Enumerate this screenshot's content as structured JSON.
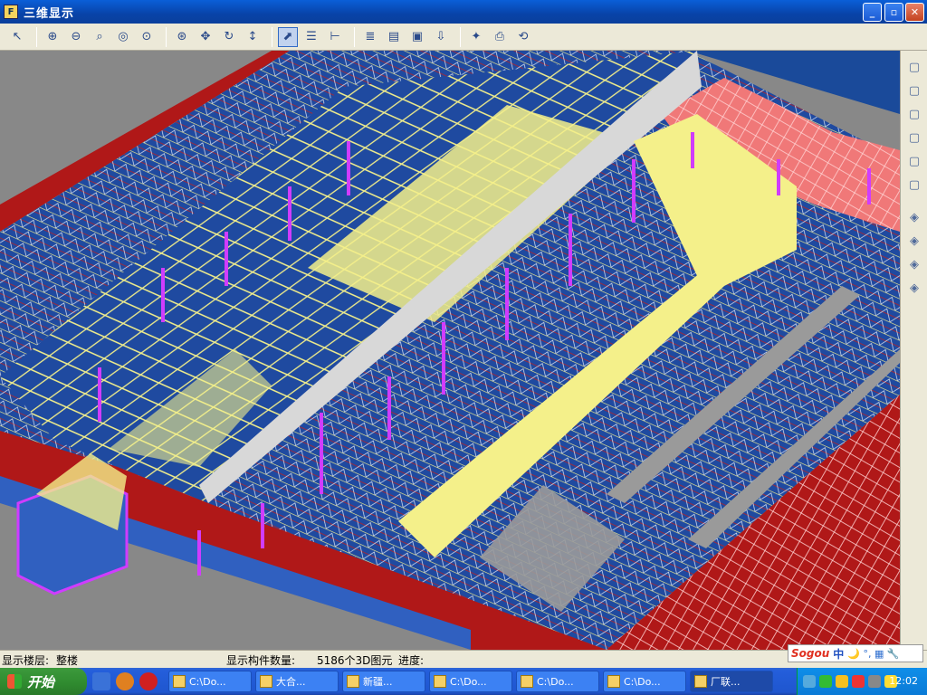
{
  "window": {
    "title": "三维显示",
    "app_icon_glyph": "F",
    "minimize_glyph": "_",
    "maximize_glyph": "▫",
    "close_glyph": "✕"
  },
  "toolbar": {
    "buttons": [
      {
        "name": "select-tool-icon",
        "glyph": "↖"
      },
      {
        "name": "zoom-in-icon",
        "glyph": "⊕"
      },
      {
        "name": "zoom-out-icon",
        "glyph": "⊖"
      },
      {
        "name": "zoom-window-icon",
        "glyph": "⌕"
      },
      {
        "name": "zoom-previous-icon",
        "glyph": "◎"
      },
      {
        "name": "zoom-all-icon",
        "glyph": "⊙"
      },
      {
        "name": "zoom-extents-icon",
        "glyph": "⊛"
      },
      {
        "name": "pan-icon",
        "glyph": "✥"
      },
      {
        "name": "rotate-icon",
        "glyph": "↻"
      },
      {
        "name": "vertical-move-icon",
        "glyph": "↕"
      },
      {
        "name": "orbit-icon",
        "glyph": "⬈"
      },
      {
        "name": "layers-icon",
        "glyph": "☰"
      },
      {
        "name": "filter-icon",
        "glyph": "⊢"
      },
      {
        "name": "list-icon",
        "glyph": "≣"
      },
      {
        "name": "properties-icon",
        "glyph": "▤"
      },
      {
        "name": "display-settings-icon",
        "glyph": "▣"
      },
      {
        "name": "export-icon",
        "glyph": "⇩"
      },
      {
        "name": "disabled-tool-icon",
        "glyph": "✦"
      },
      {
        "name": "print-preview-icon",
        "glyph": "⎙"
      },
      {
        "name": "refresh-icon",
        "glyph": "⟲"
      }
    ]
  },
  "rightbar": {
    "buttons": [
      {
        "name": "view-top-icon",
        "glyph": "▢"
      },
      {
        "name": "view-front-icon",
        "glyph": "▢"
      },
      {
        "name": "view-left-icon",
        "glyph": "▢"
      },
      {
        "name": "view-right-icon",
        "glyph": "▢"
      },
      {
        "name": "view-back-icon",
        "glyph": "▢"
      },
      {
        "name": "view-bottom-icon",
        "glyph": "▢"
      },
      {
        "name": "iso-sw-icon",
        "glyph": "◈"
      },
      {
        "name": "iso-se-icon",
        "glyph": "◈"
      },
      {
        "name": "iso-ne-icon",
        "glyph": "◈"
      },
      {
        "name": "iso-nw-icon",
        "glyph": "◈"
      }
    ]
  },
  "status": {
    "floor_label": "显示楼层:",
    "floor_value": "整楼",
    "count_label": "显示构件数量:",
    "count_value": "5186个3D图元",
    "progress_label": "进度:"
  },
  "ime": {
    "logo": "Sogou",
    "mode": "中",
    "glyphs": "🌙 °, ▦ 🔧"
  },
  "taskbar": {
    "start_label": "开始",
    "tasks": [
      {
        "label": "C:\\Do...",
        "active": false
      },
      {
        "label": "大合...",
        "active": false
      },
      {
        "label": "新疆...",
        "active": false
      },
      {
        "label": "C:\\Do...",
        "active": false
      },
      {
        "label": "C:\\Do...",
        "active": false
      },
      {
        "label": "C:\\Do...",
        "active": false
      },
      {
        "label": "厂联...",
        "active": true
      }
    ],
    "clock": "12:02"
  },
  "colors": {
    "floor_blue": "#1f4aa0",
    "truss_yellow": "#f4f08a",
    "beam_red": "#b01818",
    "column_magenta": "#d03cff",
    "purlin_red": "#c02020",
    "ground_gray": "#888888",
    "wall_gray": "#cfcfcf",
    "roof_pink": "#f07878"
  }
}
